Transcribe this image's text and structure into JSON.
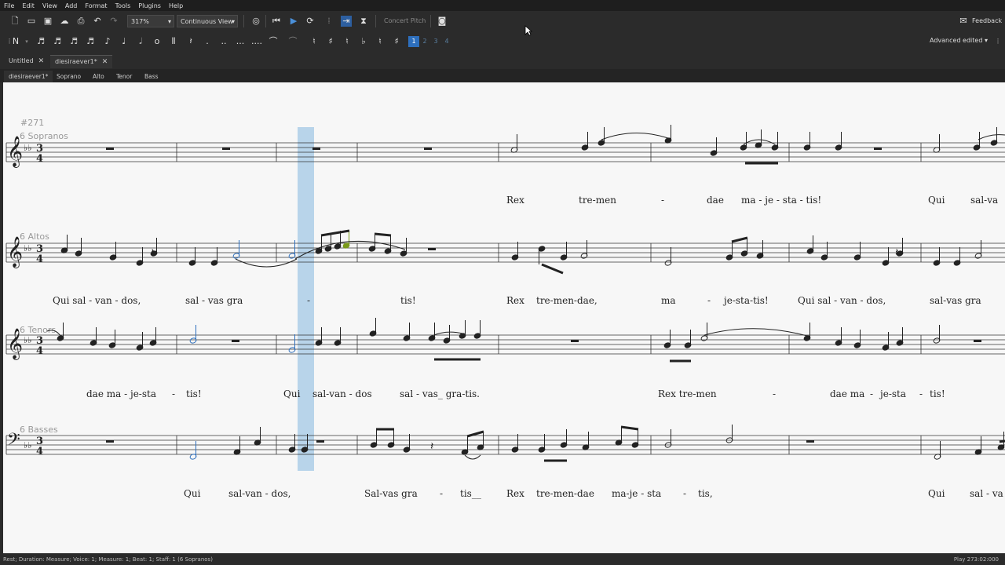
{
  "menu": [
    "File",
    "Edit",
    "View",
    "Add",
    "Format",
    "Tools",
    "Plugins",
    "Help"
  ],
  "toolbar": {
    "zoom": "317%",
    "view_mode": "Continuous View",
    "concert_pitch": "Concert Pitch",
    "feedback": "Feedback"
  },
  "palette": {
    "voices": [
      "1",
      "2",
      "3",
      "4"
    ],
    "workspace": "Advanced edited"
  },
  "tabs": [
    {
      "label": "Untitled"
    },
    {
      "label": "diesiraever1*"
    }
  ],
  "subtabs": [
    "diesiraever1*",
    "Soprano",
    "Alto",
    "Tenor",
    "Bass"
  ],
  "score": {
    "page_number": "#271",
    "instruments": [
      "6 Sopranos",
      "6 Altos",
      "6 Tenors",
      "6 Basses"
    ],
    "lyrics": {
      "soprano": [
        "Rex",
        "tre-men",
        "-",
        "dae",
        "ma - je - sta - tis!",
        "Qui",
        "sal-va"
      ],
      "alto": [
        "Qui sal - van - dos,",
        "sal - vas  gra",
        "-",
        "tis!",
        "Rex",
        "tre-men-dae,",
        "ma",
        "-",
        "je-sta-tis!",
        "Qui sal - van - dos,",
        "sal-vas  gra"
      ],
      "tenor": [
        "dae ma - je-sta",
        "-",
        "tis!",
        "Qui",
        "sal-van - dos",
        "sal - vas_ gra-tis.",
        "Rex tre-men",
        "-",
        "dae ma",
        "-",
        "je-sta",
        "-",
        "tis!"
      ],
      "bass": [
        "Qui",
        "sal-van - dos,",
        "Sal-vas gra",
        "-",
        "tis__",
        "Rex",
        "tre-men-dae",
        "ma-je - sta",
        "-",
        "tis,",
        "Qui",
        "sal - va"
      ]
    }
  },
  "status": {
    "left": "Rest; Duration: Measure; Voice: 1;  Measure: 1; Beat: 1; Staff: 1 (6 Sopranos)",
    "right": "Play  273:02:000"
  }
}
